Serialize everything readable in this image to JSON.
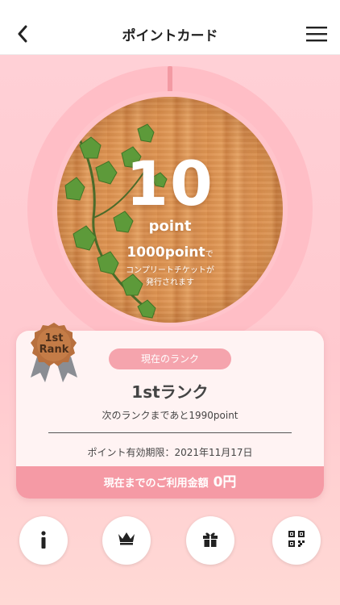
{
  "header": {
    "title": "ポイントカード",
    "back_icon": "chevron-left-icon",
    "menu_icon": "hamburger-menu-icon"
  },
  "point_card": {
    "points": "10",
    "unit": "point",
    "complete_points": "1000point",
    "complete_suffix": "で",
    "complete_desc_line1": "コンプリートチケットが",
    "complete_desc_line2": "発行されます"
  },
  "rank_badge": {
    "line1": "1st",
    "line2": "Rank"
  },
  "rank_card": {
    "pill": "現在のランク",
    "rank_name": "1stランク",
    "next_rank": "次のランクまであと1990point",
    "expiry": "ポイント有効期限：2021年11月17日",
    "usage_label": "現在までのご利用金額",
    "usage_amount": "0円"
  },
  "bottom_nav": {
    "icons": [
      "info-icon",
      "crown-icon",
      "gift-icon",
      "qr-code-icon"
    ]
  },
  "colors": {
    "background": "#ffc9cf",
    "accent": "#f59aa5",
    "badge_bronze": "#b8703e"
  }
}
